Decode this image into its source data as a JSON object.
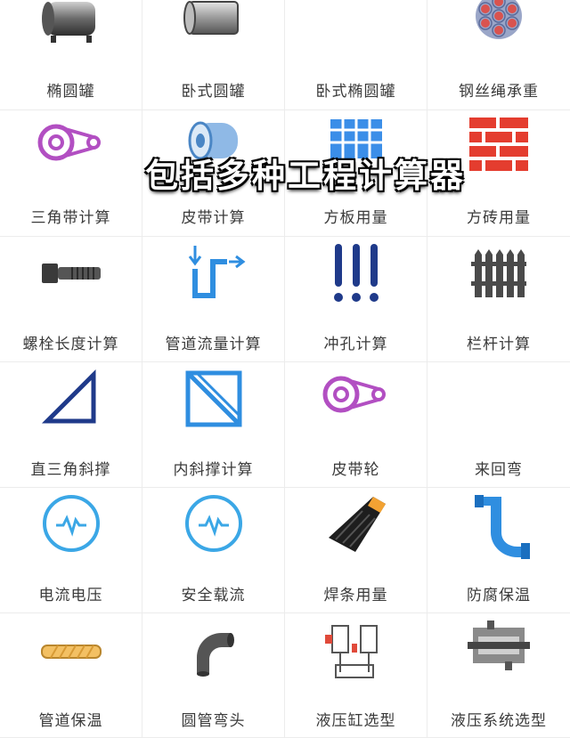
{
  "overlay_text": "包括多种工程计算器",
  "tiles": [
    {
      "label": "椭圆罐",
      "icon": "elliptical-tank-icon"
    },
    {
      "label": "卧式圆罐",
      "icon": "horizontal-cylinder-tank-icon"
    },
    {
      "label": "卧式椭圆罐",
      "icon": "horizontal-elliptical-tank-icon"
    },
    {
      "label": "钢丝绳承重",
      "icon": "wire-rope-icon"
    },
    {
      "label": "三角带计算",
      "icon": "v-belt-icon"
    },
    {
      "label": "皮带计算",
      "icon": "belt-roll-icon"
    },
    {
      "label": "方板用量",
      "icon": "square-panel-icon"
    },
    {
      "label": "方砖用量",
      "icon": "brick-wall-icon"
    },
    {
      "label": "螺栓长度计算",
      "icon": "bolt-icon"
    },
    {
      "label": "管道流量计算",
      "icon": "pipe-flow-icon"
    },
    {
      "label": "冲孔计算",
      "icon": "punch-hole-icon"
    },
    {
      "label": "栏杆计算",
      "icon": "railing-fence-icon"
    },
    {
      "label": "直三角斜撑",
      "icon": "right-triangle-brace-icon"
    },
    {
      "label": "内斜撑计算",
      "icon": "inner-diagonal-brace-icon"
    },
    {
      "label": "皮带轮",
      "icon": "pulley-icon"
    },
    {
      "label": "来回弯",
      "icon": ""
    },
    {
      "label": "电流电压",
      "icon": "current-voltage-icon"
    },
    {
      "label": "安全载流",
      "icon": "safe-current-icon"
    },
    {
      "label": "焊条用量",
      "icon": "welding-rod-icon"
    },
    {
      "label": "防腐保温",
      "icon": "pipe-insulation-icon"
    },
    {
      "label": "管道保温",
      "icon": "pipe-insulation-tube-icon"
    },
    {
      "label": "圆管弯头",
      "icon": "pipe-elbow-icon"
    },
    {
      "label": "液压缸选型",
      "icon": "hydraulic-cylinder-icon"
    },
    {
      "label": "液压系统选型",
      "icon": "hydraulic-system-icon"
    }
  ]
}
